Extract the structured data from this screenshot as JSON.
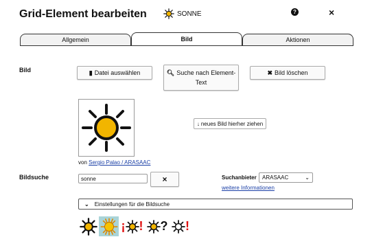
{
  "dialog": {
    "title": "Grid-Element bearbeiten",
    "element_label": "SONNE",
    "help_icon": "question-icon",
    "close_icon": "close-icon"
  },
  "tabs": [
    {
      "label": "Allgemein",
      "active": false
    },
    {
      "label": "Bild",
      "active": true
    },
    {
      "label": "Aktionen",
      "active": false
    }
  ],
  "image_section": {
    "label": "Bild",
    "select_file_label": "Datei auswählen",
    "search_by_text_label": "Suche nach Element-Text",
    "delete_image_label": "Bild löschen",
    "drop_label": "neues Bild hierher ziehen",
    "credit_prefix": "von",
    "credit_link": "Sergio Palao / ARASAAC"
  },
  "search_section": {
    "label": "Bildsuche",
    "query": "sonne",
    "provider_label": "Suchanbieter",
    "provider_value": "ARASAAC",
    "more_info_label": "weitere Informationen",
    "settings_label": "Einstellungen für die Bildsuche",
    "results": [
      {
        "icon": "sun-icon",
        "selected": false,
        "suffix": ""
      },
      {
        "icon": "sun-colored-icon",
        "selected": true,
        "suffix": ""
      },
      {
        "icon": "sun-exclamation-icon",
        "selected": false,
        "prefix": "¡",
        "suffix": "!"
      },
      {
        "icon": "sun-question-icon",
        "selected": false,
        "suffix": "?"
      },
      {
        "icon": "sun-red-exclamation-icon",
        "selected": false,
        "suffix": "!"
      }
    ]
  },
  "colors": {
    "sun_yellow": "#f2b500",
    "selection": "#a9d4d8",
    "link": "#1a3fa6",
    "red": "#e01010"
  }
}
